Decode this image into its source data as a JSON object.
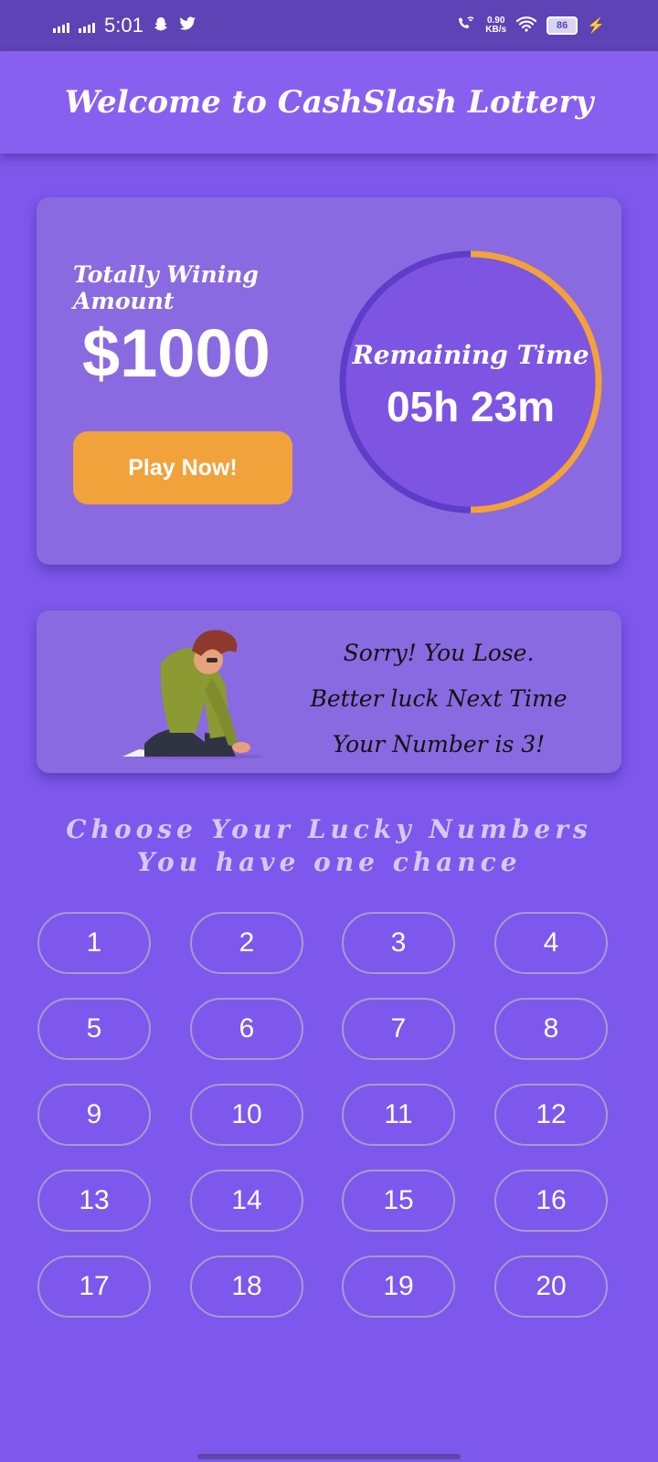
{
  "status_bar": {
    "time": "5:01",
    "net_speed": "0.90",
    "net_unit": "KB/s",
    "battery": "86",
    "icons": [
      "signal-icon",
      "signal-icon",
      "snapchat-icon",
      "twitter-icon",
      "call-wifi-icon",
      "wifi-icon",
      "battery-icon",
      "charging-icon"
    ]
  },
  "app_bar": {
    "title": "Welcome to CashSlash Lottery"
  },
  "prize": {
    "label": "Totally Wining Amount",
    "amount": "$1000",
    "play_label": "Play Now!"
  },
  "timer": {
    "label": "Remaining Time",
    "value": "05h 23m",
    "progress": 0.5,
    "ring_color": "#f2a23b",
    "track_color": "#5e3dc8"
  },
  "result": {
    "line1": "Sorry! You Lose.",
    "line2": "Better luck Next Time",
    "line3": "Your Number is 3!",
    "illustration": "sad-kneeling-man"
  },
  "instructions": {
    "line1": "Choose Your Lucky Numbers",
    "line2": "You have one chance"
  },
  "numbers": [
    "1",
    "2",
    "3",
    "4",
    "5",
    "6",
    "7",
    "8",
    "9",
    "10",
    "11",
    "12",
    "13",
    "14",
    "15",
    "16",
    "17",
    "18",
    "19",
    "20"
  ],
  "colors": {
    "background": "#7e58ec",
    "status_bar": "#5d43b5",
    "app_bar": "#8860ef",
    "card": "#8a6ae0",
    "accent": "#f2a23b"
  }
}
